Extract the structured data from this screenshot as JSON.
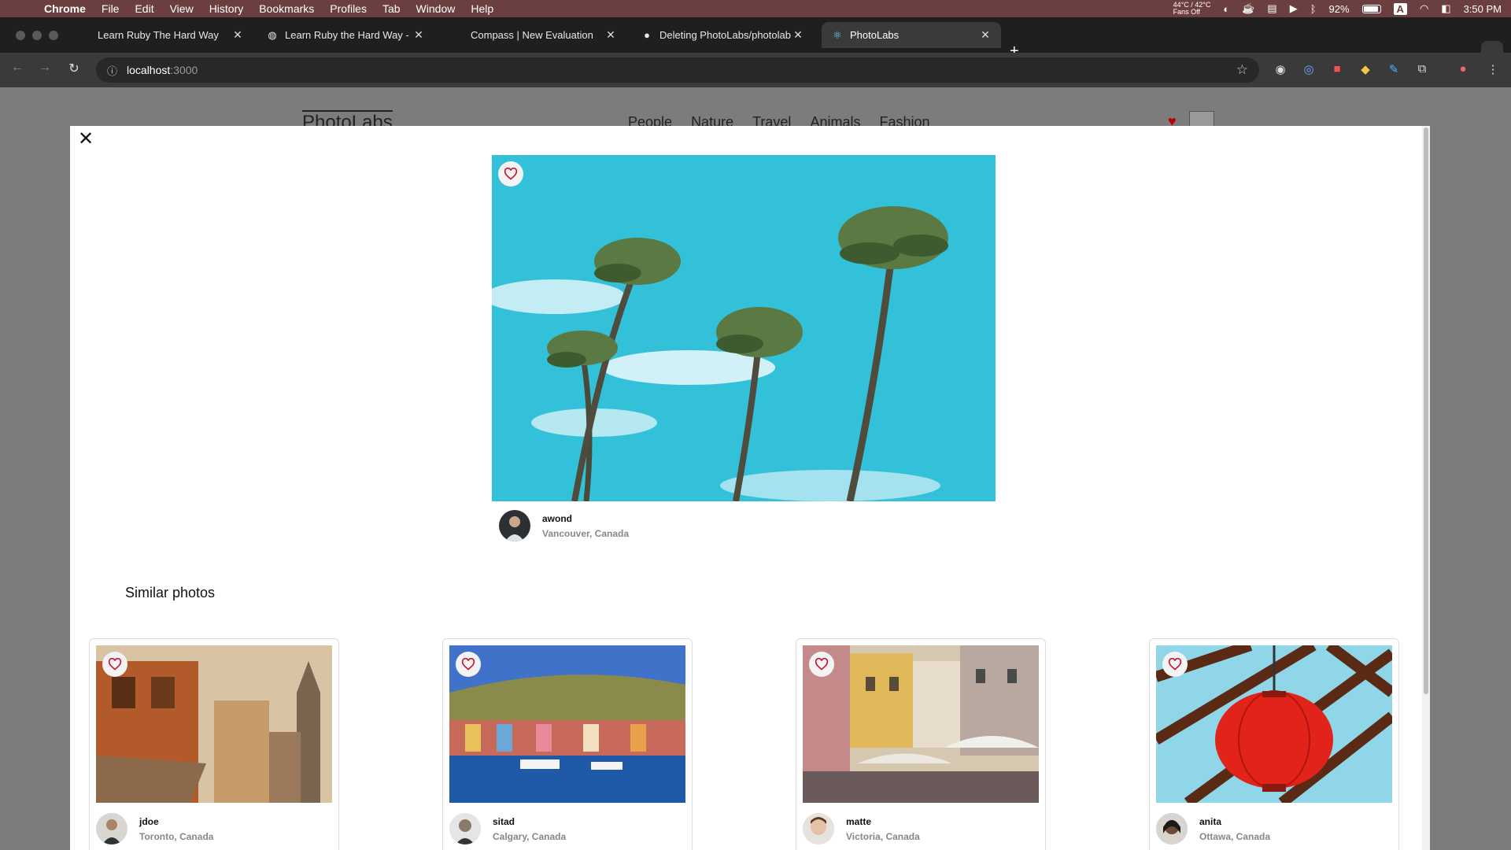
{
  "menubar": {
    "app": "Chrome",
    "items": [
      "File",
      "Edit",
      "View",
      "History",
      "Bookmarks",
      "Profiles",
      "Tab",
      "Window",
      "Help"
    ],
    "temp": "44°C / 42°C",
    "fans": "Fans Off",
    "battery": "92%",
    "input": "A",
    "time": "3:50 PM"
  },
  "tabs": [
    {
      "title": "Learn Ruby The Hard Way",
      "icon": "none"
    },
    {
      "title": "Learn Ruby the Hard Way - R",
      "icon": "globe-icon"
    },
    {
      "title": "Compass | New Evaluation",
      "icon": "none"
    },
    {
      "title": "Deleting PhotoLabs/photolab",
      "icon": "github-icon"
    },
    {
      "title": "PhotoLabs",
      "icon": "react-icon",
      "active": true
    }
  ],
  "address": {
    "host": "localhost",
    "port": ":3000"
  },
  "background_nav": {
    "logo": "PhotoLabs",
    "topics": [
      "People",
      "Nature",
      "Travel",
      "Animals",
      "Fashion"
    ]
  },
  "modal": {
    "main": {
      "username": "awond",
      "location": "Vancouver, Canada"
    },
    "similar_title": "Similar photos",
    "similar": [
      {
        "username": "jdoe",
        "location": "Toronto, Canada"
      },
      {
        "username": "sitad",
        "location": "Calgary, Canada"
      },
      {
        "username": "matte",
        "location": "Victoria, Canada"
      },
      {
        "username": "anita",
        "location": "Ottawa, Canada"
      }
    ]
  },
  "colors": {
    "accent": "#c8102e",
    "sky": "#33c1da"
  }
}
